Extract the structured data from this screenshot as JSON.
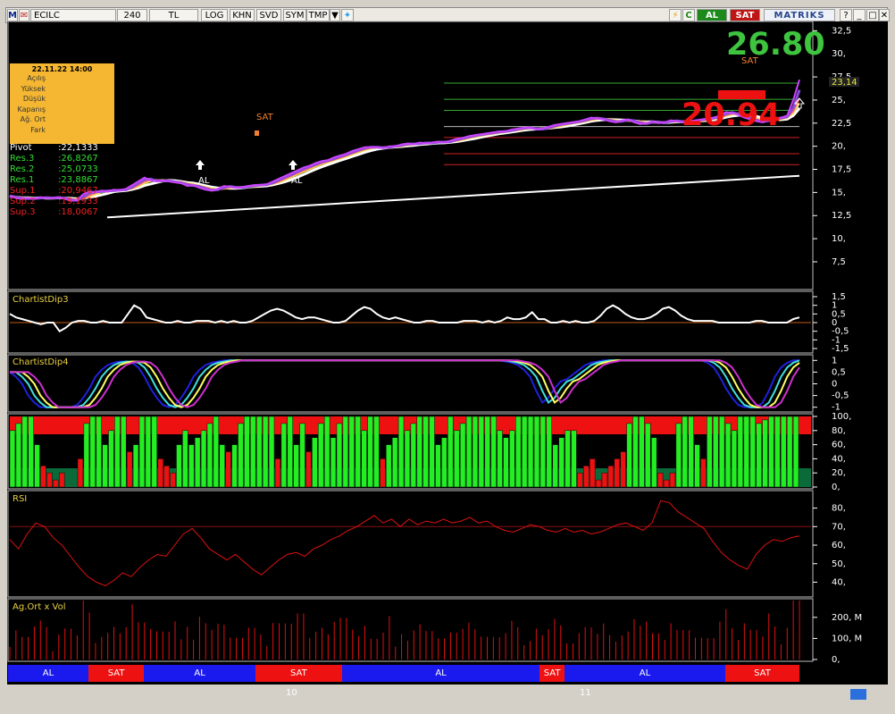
{
  "toolbar": {
    "logo": "M",
    "symbol": "ECILC",
    "period": "240",
    "currency": "TL",
    "buttons": [
      "LOG",
      "KHN",
      "SVD",
      "SYM",
      "TMP"
    ],
    "al_label": "AL",
    "sat_label": "SAT",
    "brand": "MATRIKS",
    "refresh_label": "C"
  },
  "info_box": {
    "datetime": "22.11.22 14:00",
    "rows": [
      "Açılış",
      "Yüksek",
      "Düşük",
      "Kapanış",
      "Ağ. Ort",
      "Fark"
    ]
  },
  "pivot": {
    "rows": [
      {
        "label": "Pivot",
        "value": ":22,1333",
        "color": "#ffffff"
      },
      {
        "label": "Res.3",
        "value": ":26,8267",
        "color": "#33dd33"
      },
      {
        "label": "Res.2",
        "value": ":25,0733",
        "color": "#33dd33"
      },
      {
        "label": "Res.1",
        "value": ":23,8867",
        "color": "#33dd33"
      },
      {
        "label": "Sup.1",
        "value": ":20,9467",
        "color": "#ee2222"
      },
      {
        "label": "Sup.2",
        "value": ":19,1933",
        "color": "#ee2222"
      },
      {
        "label": "Sup.3",
        "value": ":18,0067",
        "color": "#ee2222"
      }
    ]
  },
  "price_panel": {
    "big_high": "26.80",
    "big_low": "20.94",
    "last_price": "23,14",
    "y_ticks": [
      "32,5",
      "30,",
      "27,5",
      "25,",
      "22,5",
      "20,",
      "17,5",
      "15,",
      "12,5",
      "10,",
      "7,5"
    ],
    "annotations": {
      "sat1": "SAT",
      "sat2": "SAT",
      "al1": "AL",
      "al2": "AL"
    }
  },
  "panels": {
    "dip3_title": "ChartistDip3",
    "dip3_ticks": [
      "1,5",
      "1",
      "0,5",
      "0",
      "-0,5",
      "-1",
      "-1,5"
    ],
    "dip4_title": "ChartistDip4",
    "dip4_ticks": [
      "1",
      "0,5",
      "0",
      "-0,5",
      "-1"
    ],
    "bars_ticks": [
      "100,",
      "80,",
      "60,",
      "40,",
      "20,",
      "0,"
    ],
    "rsi_title": "RSI",
    "rsi_ticks": [
      "80,",
      "70,",
      "60,",
      "50,",
      "40,"
    ],
    "vol_title": "Ag.Ort x Vol",
    "vol_ticks": [
      "200, M",
      "100, M",
      "0,"
    ]
  },
  "signal_bar": [
    {
      "label": "AL",
      "color": "#1a1aee",
      "start": 0,
      "end": 13
    },
    {
      "label": "SAT",
      "color": "#ee1111",
      "start": 13,
      "end": 22
    },
    {
      "label": "AL",
      "color": "#1a1aee",
      "start": 22,
      "end": 40
    },
    {
      "label": "SAT",
      "color": "#ee1111",
      "start": 40,
      "end": 54
    },
    {
      "label": "AL",
      "color": "#1a1aee",
      "start": 54,
      "end": 86
    },
    {
      "label": "SAT",
      "color": "#ee1111",
      "start": 86,
      "end": 90
    },
    {
      "label": "AL",
      "color": "#1a1aee",
      "start": 90,
      "end": 116
    },
    {
      "label": "SAT",
      "color": "#ee1111",
      "start": 116,
      "end": 128
    }
  ],
  "x_axis": {
    "labels": [
      "10",
      "11"
    ]
  },
  "colors": {
    "background": "#000000",
    "grid": "#666666",
    "green_text": "#3ec43e",
    "red_text": "#ee1111"
  },
  "chart_data": {
    "type": "line",
    "title": "ECILC",
    "price_series": {
      "name": "ECILC",
      "values": [
        14.6,
        14.4,
        14.3,
        14.4,
        14.3,
        14.5,
        14.4,
        14.4,
        14.5,
        14.3,
        14.1,
        14.2,
        14.8,
        15.1,
        15.0,
        15.2,
        15.1,
        15.3,
        15.2,
        15.4,
        15.8,
        16.2,
        16.6,
        16.3,
        16.2,
        16.3,
        16.2,
        16.1,
        16.0,
        15.7,
        15.8,
        15.5,
        15.3,
        15.2,
        15.4,
        15.7,
        15.6,
        15.5,
        15.6,
        15.7,
        15.8,
        15.8,
        15.9,
        16.2,
        16.5,
        16.8,
        17.1,
        17.4,
        17.7,
        17.9,
        18.2,
        18.4,
        18.5,
        18.8,
        19.0,
        19.2,
        19.5,
        19.7,
        19.9,
        19.9,
        19.9,
        19.8,
        20.0,
        20.0,
        20.2,
        20.3,
        20.2,
        20.4,
        20.3,
        20.4,
        20.5,
        20.4,
        20.6,
        20.8,
        20.9,
        21.1,
        21.2,
        21.3,
        21.4,
        21.5,
        21.6,
        21.6,
        21.8,
        21.9,
        22.0,
        22.0,
        21.8,
        21.9,
        22.1,
        22.3,
        22.4,
        22.5,
        22.6,
        22.7,
        22.9,
        23.1,
        23.0,
        22.9,
        22.7,
        22.6,
        22.8,
        22.9,
        22.6,
        22.4,
        22.5,
        22.7,
        22.5,
        22.6,
        22.8,
        22.7,
        22.6,
        22.7,
        22.8,
        22.9,
        23.0,
        23.1,
        23.3,
        23.7,
        23.6,
        23.4,
        23.1,
        22.9,
        22.7,
        22.6,
        22.9,
        23.0,
        23.1,
        23.3,
        25.0,
        27.2
      ]
    },
    "trendline": {
      "start": 12.3,
      "end": 16.8
    },
    "pivot_levels": [
      26.8267,
      25.0733,
      23.8867,
      22.1333,
      20.9467,
      19.1933,
      18.0067
    ],
    "dip3_values": [
      0.5,
      0.3,
      0.2,
      0.1,
      0,
      -0.1,
      0,
      0,
      -0.5,
      -0.3,
      0,
      0.1,
      0.1,
      0,
      0,
      0.1,
      0,
      0,
      0,
      0.5,
      1.0,
      0.8,
      0.3,
      0.2,
      0.1,
      0,
      0,
      0.1,
      0,
      0,
      0.1,
      0.1,
      0.1,
      0,
      0.1,
      0,
      0.1,
      0,
      0,
      0.1,
      0.3,
      0.5,
      0.7,
      0.8,
      0.7,
      0.5,
      0.3,
      0.2,
      0.3,
      0.3,
      0.2,
      0.1,
      0,
      0,
      0.1,
      0.4,
      0.7,
      0.9,
      0.8,
      0.5,
      0.3,
      0.2,
      0.3,
      0.2,
      0.1,
      0,
      0,
      0.1,
      0.1,
      0,
      0,
      0,
      0,
      0.1,
      0.1,
      0.1,
      0,
      0.1,
      0,
      0.1,
      0.3,
      0.2,
      0.2,
      0.3,
      0.6,
      0.2,
      0.2,
      0,
      0,
      0.1,
      0,
      0.1,
      0,
      0,
      0.1,
      0.4,
      0.8,
      1.0,
      0.8,
      0.5,
      0.3,
      0.2,
      0.2,
      0.3,
      0.5,
      0.8,
      0.9,
      0.7,
      0.4,
      0.2,
      0.1,
      0.1,
      0.1,
      0.1,
      0,
      0,
      0,
      0,
      0,
      0,
      0.1,
      0.1,
      0,
      0,
      0,
      0,
      0.2,
      0.3
    ],
    "dip4_values": [
      0.5,
      0.3,
      0,
      -0.5,
      -0.8,
      -1,
      -1,
      -1,
      -1,
      -1,
      -1,
      -0.9,
      -0.6,
      -0.2,
      0.3,
      0.6,
      0.8,
      0.9,
      0.95,
      0.95,
      0.9,
      0.7,
      0.3,
      -0.2,
      -0.6,
      -0.9,
      -1,
      -0.9,
      -0.6,
      -0.2,
      0.3,
      0.6,
      0.8,
      0.9,
      0.95,
      1,
      1,
      1,
      1,
      1,
      1,
      1,
      1,
      1,
      1,
      1,
      1,
      1,
      1,
      1,
      1,
      1,
      1,
      1,
      1,
      1,
      1,
      1,
      1,
      1,
      1,
      1,
      1,
      1,
      1,
      1,
      1,
      1,
      1,
      1,
      1,
      1,
      1,
      1,
      1,
      1,
      1,
      1,
      1,
      1,
      1,
      0.95,
      0.9,
      0.8,
      0.6,
      0.3,
      -0.3,
      -0.8,
      -0.6,
      -0.2,
      0.1,
      0.2,
      0.4,
      0.6,
      0.8,
      0.9,
      0.95,
      1,
      1,
      1,
      1,
      1,
      1,
      1,
      1,
      1,
      1,
      1,
      1,
      1,
      1,
      1,
      1,
      1,
      0.9,
      0.7,
      0.3,
      -0.2,
      -0.6,
      -0.9,
      -1,
      -1,
      -1,
      -0.8,
      -0.3,
      0.3,
      0.7,
      0.9,
      1,
      1
    ],
    "bar_values": [
      80,
      90,
      100,
      100,
      60,
      30,
      20,
      10,
      20,
      0,
      0,
      40,
      90,
      100,
      100,
      60,
      80,
      100,
      100,
      50,
      60,
      100,
      100,
      100,
      40,
      30,
      20,
      60,
      80,
      60,
      70,
      80,
      90,
      100,
      60,
      50,
      60,
      90,
      100,
      100,
      100,
      100,
      100,
      40,
      90,
      100,
      60,
      90,
      50,
      70,
      90,
      100,
      70,
      90,
      100,
      100,
      100,
      80,
      100,
      100,
      40,
      60,
      70,
      100,
      80,
      90,
      100,
      100,
      100,
      60,
      70,
      100,
      80,
      90,
      100,
      100,
      100,
      100,
      100,
      80,
      70,
      80,
      100,
      100,
      100,
      100,
      100,
      100,
      60,
      70,
      80,
      80,
      20,
      30,
      40,
      10,
      20,
      30,
      40,
      50,
      90,
      100,
      100,
      90,
      70,
      20,
      10,
      20,
      90,
      100,
      100,
      60,
      40,
      100,
      100,
      100,
      90,
      80,
      100,
      100,
      100,
      90,
      95,
      100,
      100,
      100,
      100,
      100
    ],
    "rsi_values": [
      63,
      58,
      66,
      72,
      70,
      64,
      60,
      54,
      48,
      43,
      40,
      38,
      41,
      45,
      43,
      48,
      52,
      55,
      54,
      60,
      66,
      69,
      64,
      58,
      55,
      52,
      55,
      51,
      47,
      44,
      48,
      52,
      55,
      56,
      54,
      58,
      60,
      63,
      65,
      68,
      70,
      73,
      76,
      72,
      74,
      70,
      74,
      71,
      73,
      72,
      74,
      72,
      73,
      75,
      72,
      73,
      70,
      68,
      67,
      69,
      71,
      70,
      68,
      67,
      69,
      67,
      68,
      66,
      67,
      69,
      71,
      72,
      70,
      68,
      72,
      84,
      83,
      78,
      75,
      72,
      69,
      62,
      56,
      52,
      49,
      47,
      55,
      60,
      63,
      62,
      64,
      65
    ]
  }
}
